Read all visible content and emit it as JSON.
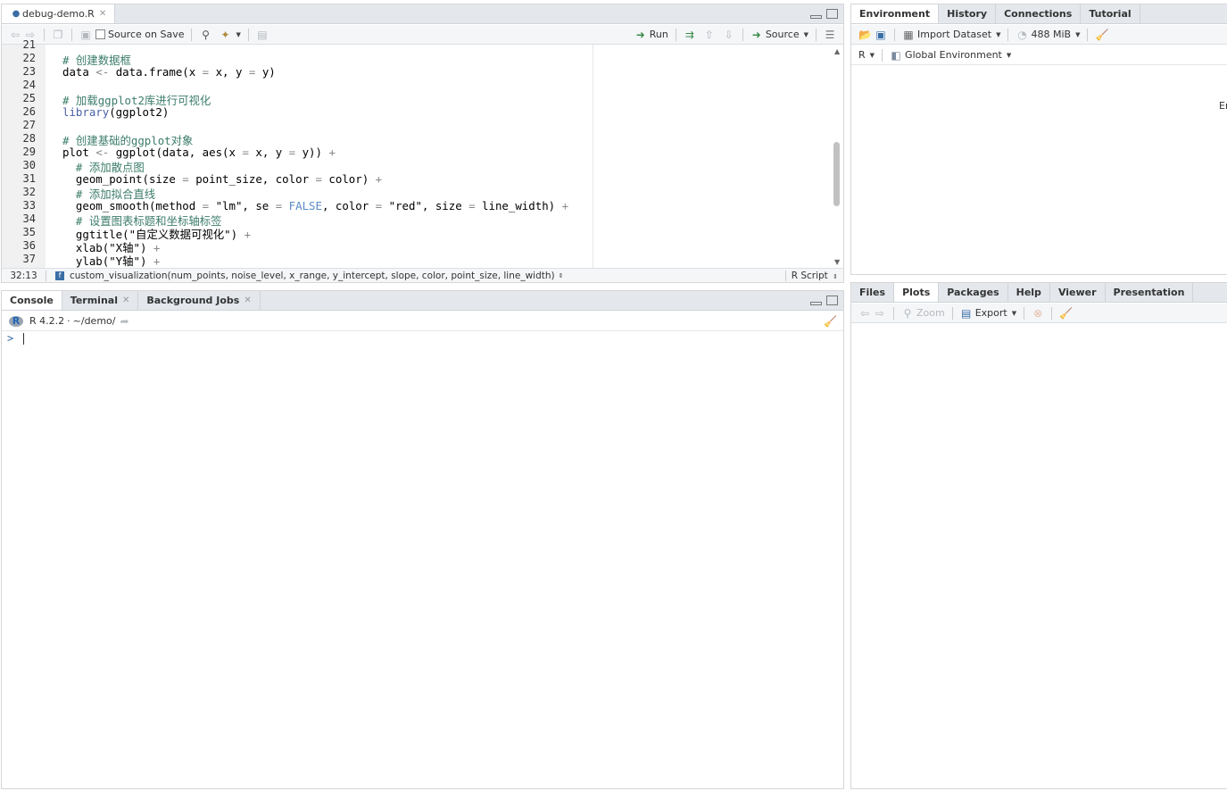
{
  "editor": {
    "tab_label": "debug-demo.R",
    "source_on_save": "Source on Save",
    "run": "Run",
    "source": "Source",
    "lines": [
      {
        "n": "21",
        "html": ""
      },
      {
        "n": "22",
        "html": "<span class=\"cm\"># 创建数据框</span>"
      },
      {
        "n": "23",
        "html": "data <span class=\"op\">&lt;-</span> data.frame(x <span class=\"op\">=</span> x, y <span class=\"op\">=</span> y)"
      },
      {
        "n": "24",
        "html": ""
      },
      {
        "n": "25",
        "html": "<span class=\"cm\"># 加载ggplot2库进行可视化</span>"
      },
      {
        "n": "26",
        "html": "<span class=\"kw\">library</span>(ggplot2)"
      },
      {
        "n": "27",
        "html": ""
      },
      {
        "n": "28",
        "html": "<span class=\"cm\"># 创建基础的ggplot对象</span>"
      },
      {
        "n": "29",
        "html": "plot <span class=\"op\">&lt;-</span> ggplot(data, aes(x <span class=\"op\">=</span> x, y <span class=\"op\">=</span> y)) <span class=\"op\">+</span>"
      },
      {
        "n": "30",
        "html": "  <span class=\"cm\"># 添加散点图</span>"
      },
      {
        "n": "31",
        "html": "  geom_point(size <span class=\"op\">=</span> point_size, color <span class=\"op\">=</span> color) <span class=\"op\">+</span>"
      },
      {
        "n": "32",
        "html": "  <span class=\"cm\"># 添加拟合直线</span>"
      },
      {
        "n": "33",
        "html": "  geom_smooth(method <span class=\"op\">=</span> \"lm\", se <span class=\"op\">=</span> <span class=\"kc\">FALSE</span>, color <span class=\"op\">=</span> \"red\", size <span class=\"op\">=</span> line_width) <span class=\"op\">+</span>"
      },
      {
        "n": "34",
        "html": "  <span class=\"cm\"># 设置图表标题和坐标轴标签</span>"
      },
      {
        "n": "35",
        "html": "  ggtitle(\"自定义数据可视化\") <span class=\"op\">+</span>"
      },
      {
        "n": "36",
        "html": "  xlab(\"X轴\") <span class=\"op\">+</span>"
      },
      {
        "n": "37",
        "html": "  ylab(\"Y轴\") <span class=\"op\">+</span>"
      }
    ],
    "cursor_pos": "32:13",
    "function_sig": "custom_visualization(num_points, noise_level, x_range, y_intercept, slope, color, point_size, line_width)",
    "file_type": "R Script"
  },
  "console": {
    "tabs": [
      "Console",
      "Terminal",
      "Background Jobs"
    ],
    "r_version": "R 4.2.2",
    "path": "~/demo/",
    "prompt": ">"
  },
  "environment": {
    "tabs": [
      "Environment",
      "History",
      "Connections",
      "Tutorial"
    ],
    "import_dataset": "Import Dataset",
    "memory": "488 MiB",
    "lang": "R",
    "scope": "Global Environment",
    "empty_text": "Er"
  },
  "files": {
    "tabs": [
      "Files",
      "Plots",
      "Packages",
      "Help",
      "Viewer",
      "Presentation"
    ],
    "zoom": "Zoom",
    "export": "Export"
  }
}
